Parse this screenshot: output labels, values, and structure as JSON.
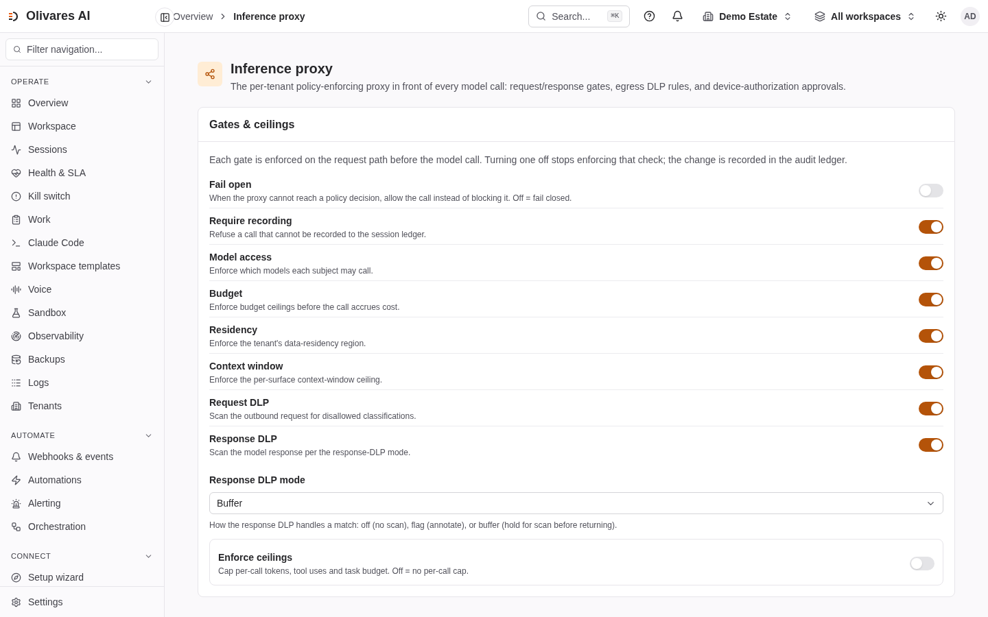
{
  "brand": {
    "name": "Olivares AI"
  },
  "breadcrumb": [
    "Overview",
    "Inference proxy"
  ],
  "topbar": {
    "search": {
      "placeholder": "Search...",
      "shortcut": "⌘K"
    },
    "tenant": "Demo Estate",
    "workspace": "All workspaces",
    "avatar": "AD"
  },
  "sidebar": {
    "filter": {
      "placeholder": "Filter navigation..."
    },
    "sections": [
      {
        "title": "OPERATE",
        "expanded": true,
        "items": [
          {
            "label": "Overview",
            "selected": false
          },
          {
            "label": "Workspace",
            "selected": false
          },
          {
            "label": "Sessions",
            "selected": false
          },
          {
            "label": "Health & SLA",
            "selected": false
          },
          {
            "label": "Kill switch",
            "selected": false
          },
          {
            "label": "Work",
            "selected": false
          },
          {
            "label": "Claude Code",
            "selected": false
          },
          {
            "label": "Workspace templates",
            "selected": false
          },
          {
            "label": "Voice",
            "selected": false
          },
          {
            "label": "Sandbox",
            "selected": false
          },
          {
            "label": "Observability",
            "selected": false
          },
          {
            "label": "Backups",
            "selected": false
          },
          {
            "label": "Logs",
            "selected": false
          },
          {
            "label": "Tenants",
            "selected": false
          }
        ]
      },
      {
        "title": "AUTOMATE",
        "expanded": true,
        "items": [
          {
            "label": "Webhooks & events",
            "selected": false
          },
          {
            "label": "Automations",
            "selected": false
          },
          {
            "label": "Alerting",
            "selected": false
          },
          {
            "label": "Orchestration",
            "selected": false
          }
        ]
      },
      {
        "title": "CONNECT",
        "expanded": true,
        "items": [
          {
            "label": "Setup wizard",
            "selected": false
          }
        ]
      }
    ],
    "footer": {
      "label": "Settings"
    }
  },
  "page": {
    "title": "Inference proxy",
    "description": "The per-tenant policy-enforcing proxy in front of every model call: request/response gates, egress DLP rules, and device-authorization approvals."
  },
  "card": {
    "title": "Gates & ceilings",
    "intro": "Each gate is enforced on the request path before the model call. Turning one off stops enforcing that check; the change is recorded in the audit ledger.",
    "gates": [
      {
        "label": "Fail open",
        "description": "When the proxy cannot reach a policy decision, allow the call instead of blocking it. Off = fail closed.",
        "on": false
      },
      {
        "label": "Require recording",
        "description": "Refuse a call that cannot be recorded to the session ledger.",
        "on": true
      },
      {
        "label": "Model access",
        "description": "Enforce which models each subject may call.",
        "on": true
      },
      {
        "label": "Budget",
        "description": "Enforce budget ceilings before the call accrues cost.",
        "on": true
      },
      {
        "label": "Residency",
        "description": "Enforce the tenant's data-residency region.",
        "on": true
      },
      {
        "label": "Context window",
        "description": "Enforce the per-surface context-window ceiling.",
        "on": true
      },
      {
        "label": "Request DLP",
        "description": "Scan the outbound request for disallowed classifications.",
        "on": true
      },
      {
        "label": "Response DLP",
        "description": "Scan the model response per the response-DLP mode.",
        "on": true
      }
    ],
    "dlp_mode": {
      "label": "Response DLP mode",
      "value": "Buffer",
      "help": "How the response DLP handles a match: off (no scan), flag (annotate), or buffer (hold for scan before returning)."
    },
    "ceilings": {
      "label": "Enforce ceilings",
      "description": "Cap per-call tokens, tool uses and task budget. Off = no per-call cap.",
      "on": false
    }
  }
}
